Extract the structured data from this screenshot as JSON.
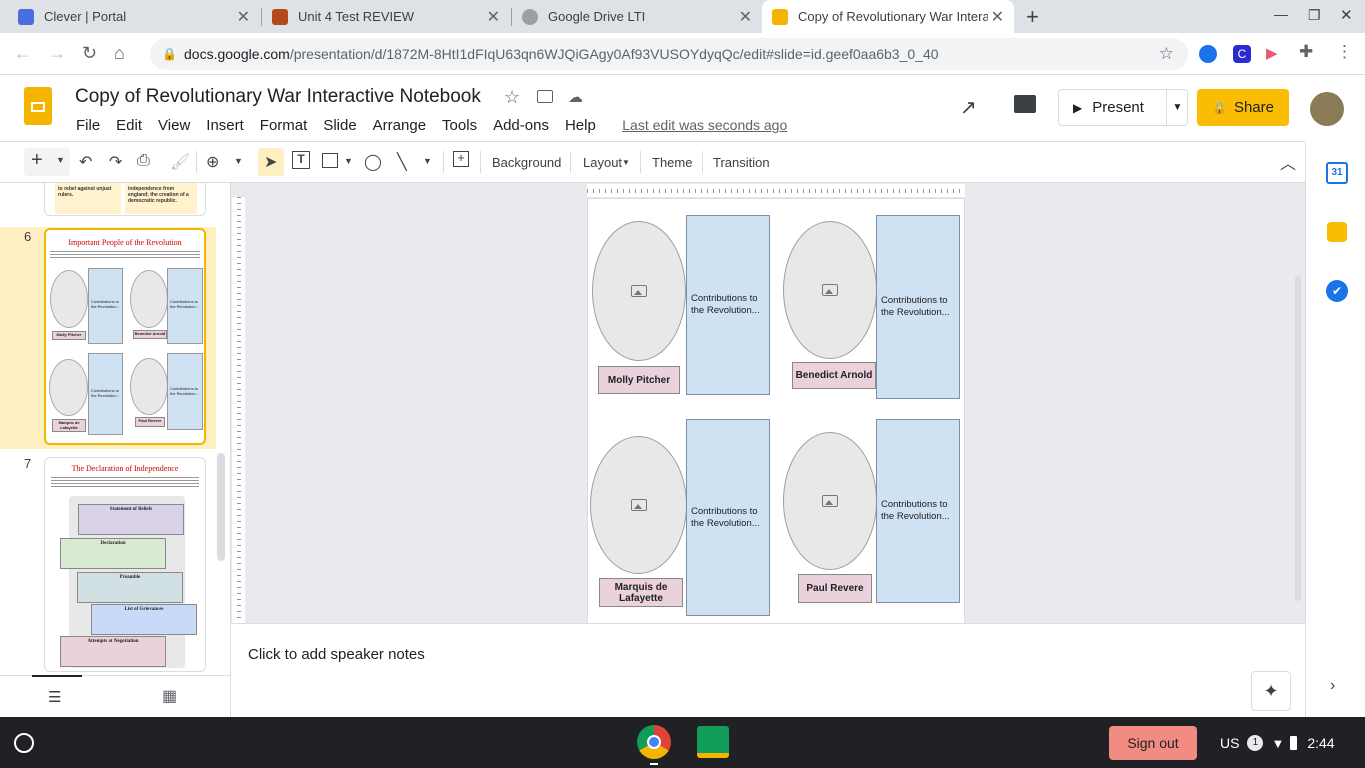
{
  "browser": {
    "tabs": [
      {
        "title": "Clever | Portal",
        "color": "#4a6ee0"
      },
      {
        "title": "Unit 4 Test REVIEW",
        "color": "#b34a1c"
      },
      {
        "title": "Google Drive LTI",
        "color": "#5f6368"
      },
      {
        "title": "Copy of Revolutionary War Intera",
        "color": "#f4b400"
      }
    ],
    "new_tab": "+",
    "url_host": "docs.google.com",
    "url_path": "/presentation/d/1872M-8HtI1dFIqU63qn6WJQiGAgy0Af93VUSOYdyqQc/edit#slide=id.geef0aa6b3_0_40"
  },
  "app": {
    "title": "Copy of Revolutionary War Interactive Notebook",
    "menu": [
      "File",
      "Edit",
      "View",
      "Insert",
      "Format",
      "Slide",
      "Arrange",
      "Tools",
      "Add-ons",
      "Help"
    ],
    "last_edit": "Last edit was seconds ago",
    "present": "Present",
    "share": "Share",
    "accent": "#fbbc04"
  },
  "toolbar": {
    "background": "Background",
    "layout": "Layout",
    "theme": "Theme",
    "transition": "Transition"
  },
  "filmstrip": {
    "slide5_text": [
      "to rebel against unjust rulers.",
      "independence from england; the creation of a democratic republic."
    ],
    "slide6": {
      "number": "6",
      "title": "Important People of the Revolution",
      "labels": [
        "Molly Pitcher",
        "Benedict Arnold",
        "Marquis de Lafayette",
        "Paul Revere"
      ],
      "box": "Contributions to the Revolution..."
    },
    "slide7": {
      "number": "7",
      "title": "The Declaration of Independence",
      "sections": [
        "Statement of Beliefs",
        "Declaration",
        "Preamble",
        "List of Grievances",
        "Attempts at Negotiation"
      ]
    }
  },
  "slide": {
    "people": [
      "Molly Pitcher",
      "Benedict Arnold",
      "Marquis de Lafayette",
      "Paul Revere"
    ],
    "contribution_text": "Contributions to the Revolution..."
  },
  "notes": {
    "placeholder": "Click to add speaker notes"
  },
  "taskbar": {
    "sign_out": "Sign out",
    "locale": "US",
    "notif_count": "1",
    "time": "2:44"
  }
}
